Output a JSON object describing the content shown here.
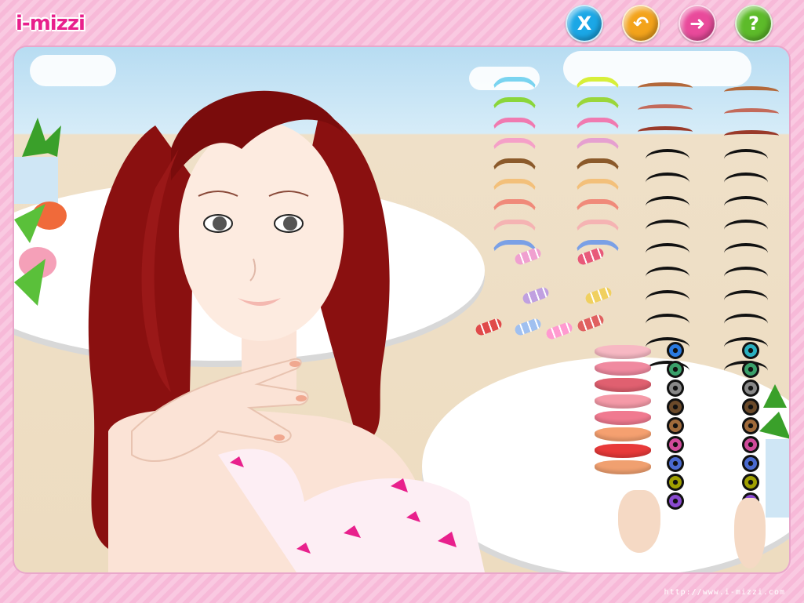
{
  "app": {
    "logo_text": "i-mizzi",
    "footer_url": "http://www.i-mizzi.com"
  },
  "toolbar": [
    {
      "name": "close-button",
      "glyph": "X",
      "color": "#1ba7e6"
    },
    {
      "name": "undo-button",
      "glyph": "↶",
      "color": "#f3a31b"
    },
    {
      "name": "next-button",
      "glyph": "➜",
      "color": "#e94a9b"
    },
    {
      "name": "help-button",
      "glyph": "?",
      "color": "#5dbb2a"
    }
  ],
  "palettes": {
    "eyeshadow_left": [
      "#7ad4f0",
      "#8ad63a",
      "#f07ab0",
      "#f5a0c8",
      "#8b5a2b",
      "#f3c07a",
      "#f08a7a",
      "#f5b3b3",
      "#7aa0e6"
    ],
    "eyeshadow_right": [
      "#d7ef3a",
      "#9ad63a",
      "#f07ab0",
      "#e6a0d0",
      "#8b5a2b",
      "#f3c07a",
      "#f08a7a",
      "#f5b3b3",
      "#7aa0e6"
    ],
    "eyebrows": [
      "#b3683a",
      "#c36a5a",
      "#9a3a2a"
    ],
    "lashes_count": 10,
    "lips": [
      "#f7b8c3",
      "#f08aa0",
      "#e06070",
      "#f59aa8",
      "#f07a90",
      "#f5a070",
      "#e83a3a",
      "#f0a070"
    ],
    "eyes_left": [
      "#2a7ae0",
      "#3aa06a",
      "#888888",
      "#6b4a2a",
      "#a06a3a",
      "#d04a9a",
      "#4a6ad0",
      "#a0a000",
      "#8a4ad0"
    ],
    "eyes_right": [
      "#2ab0c0",
      "#3aa06a",
      "#888888",
      "#6b4a2a",
      "#a06a3a",
      "#d04a9a",
      "#4a6ad0",
      "#a0a000",
      "#8a4ad0"
    ],
    "nails": [
      "#f0a0d0",
      "#e85a7a",
      "#c0a0e0",
      "#f0d060",
      "#e04a4a",
      "#a0c0f0",
      "#ff9ad0",
      "#e06060"
    ]
  }
}
